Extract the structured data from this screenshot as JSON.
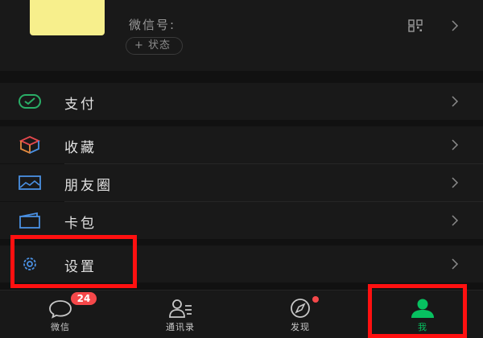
{
  "profile": {
    "wechat_id_label": "微信号:",
    "status_label": "+ 状态",
    "icons": {
      "qr": "qr-code-icon",
      "chevron": "chevron-right-icon"
    }
  },
  "menu": {
    "pay": {
      "label": "支付",
      "icon": "pay-check-icon",
      "color": "#2aae67"
    },
    "favorites": {
      "label": "收藏",
      "icon": "favorites-cube-icon",
      "color": "#e58a3d"
    },
    "moments": {
      "label": "朋友圈",
      "icon": "moments-image-icon",
      "color": "#4a90e2"
    },
    "cards": {
      "label": "卡包",
      "icon": "card-wallet-icon",
      "color": "#4a90e2"
    },
    "settings": {
      "label": "设置",
      "icon": "settings-gear-icon",
      "color": "#4a90e2"
    }
  },
  "tabbar": {
    "chats": {
      "label": "微信",
      "badge": "24",
      "icon": "chat-bubble-icon"
    },
    "contacts": {
      "label": "通讯录",
      "icon": "contacts-icon"
    },
    "discover": {
      "label": "发现",
      "icon": "compass-icon",
      "dot": true
    },
    "me": {
      "label": "我",
      "icon": "person-icon",
      "active": true
    }
  },
  "colors": {
    "background": "#111111",
    "surface": "#191919",
    "accent": "#07c160",
    "badge": "#f5484a",
    "annotation": "#ff1010"
  }
}
